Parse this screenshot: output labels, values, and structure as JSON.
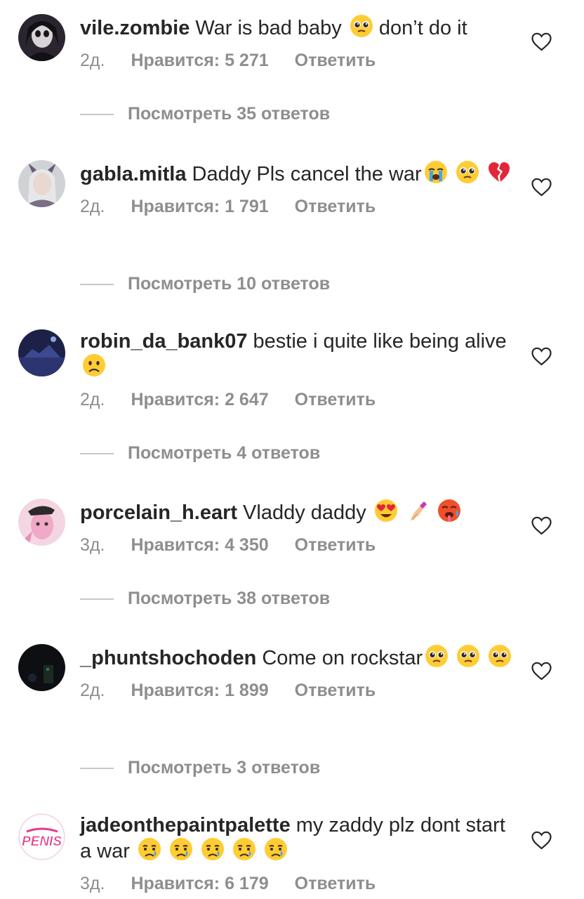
{
  "comments": [
    {
      "username": "vile.zombie",
      "text": "War is bad baby",
      "emoji_mid": [
        "pleading-face"
      ],
      "text_after": "don’t do it",
      "emoji_end": [],
      "time": "2д.",
      "likes": "Нравится: 5 271",
      "reply": "Ответить",
      "view_replies": "Посмотреть 35 ответов"
    },
    {
      "username": "gabla.mitla",
      "text": "Daddy Pls cancel the war",
      "emoji_mid": [],
      "text_after": "",
      "emoji_end": [
        "loudly-crying-face",
        "pleading-face",
        "broken-heart"
      ],
      "time": "2д.",
      "likes": "Нравится: 1 791",
      "reply": "Ответить",
      "view_replies": "Посмотреть 10 ответов"
    },
    {
      "username": "robin_da_bank07",
      "text": "bestie i quite like being alive",
      "emoji_mid": [],
      "text_after": "",
      "emoji_end": [
        "frowning-face"
      ],
      "time": "2д.",
      "likes": "Нравится: 2 647",
      "reply": "Ответить",
      "view_replies": "Посмотреть 4 ответов"
    },
    {
      "username": "porcelain_h.eart",
      "text": "Vladdy daddy",
      "emoji_mid": [],
      "text_after": "",
      "emoji_end": [
        "heart-eyes-face",
        "nail-polish",
        "hot-face"
      ],
      "time": "3д.",
      "likes": "Нравится: 4 350",
      "reply": "Ответить",
      "view_replies": "Посмотреть 38 ответов"
    },
    {
      "username": "_phuntshochoden",
      "text": "Come on rockstar",
      "emoji_mid": [],
      "text_after": "",
      "emoji_end": [
        "pleading-face",
        "pleading-face",
        "pleading-face"
      ],
      "time": "2д.",
      "likes": "Нравится: 1 899",
      "reply": "Ответить",
      "view_replies": "Посмотреть 3 ответов"
    },
    {
      "username": "jadeonthepaintpalette",
      "text": "my zaddy plz dont start a war",
      "emoji_mid": [],
      "text_after": "",
      "emoji_end": [
        "crying-face",
        "crying-face",
        "crying-face",
        "crying-face",
        "crying-face"
      ],
      "time": "3д.",
      "likes": "Нравится: 6 179",
      "reply": "Ответить"
    }
  ],
  "avatar_logo_text": "PENIS",
  "colors": {
    "text": "#262626",
    "muted": "#8e8e8e",
    "line": "#c7c7c7",
    "heart_stroke": "#262626"
  }
}
